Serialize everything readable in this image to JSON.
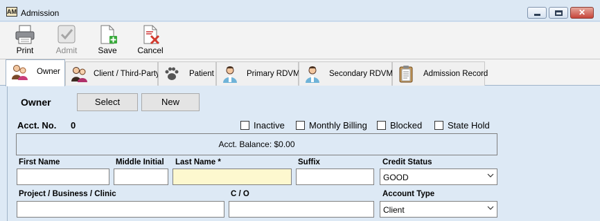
{
  "window": {
    "title": "Admission",
    "app_icon_text": "AM",
    "close_glyph": "✕"
  },
  "toolbar": {
    "print_label": "Print",
    "admit_label": "Admit",
    "save_label": "Save",
    "cancel_label": "Cancel"
  },
  "tabs": [
    {
      "label": "Owner",
      "icon": "owner-people-icon",
      "active": true
    },
    {
      "label": "Client / Third-Party",
      "icon": "client-people-icon"
    },
    {
      "label": "Patient",
      "icon": "paw-print-icon"
    },
    {
      "label": "Primary RDVM",
      "icon": "doctor-icon"
    },
    {
      "label": "Secondary RDVM",
      "icon": "doctor-icon"
    },
    {
      "label": "Admission Record",
      "icon": "clipboard-icon"
    }
  ],
  "owner": {
    "section_title": "Owner",
    "select_label": "Select",
    "new_label": "New",
    "acct_label": "Acct. No.",
    "acct_value": "0",
    "checkboxes": {
      "inactive": "Inactive",
      "monthly_billing": "Monthly Billing",
      "blocked": "Blocked",
      "state_hold": "State Hold"
    },
    "balance_text": "Acct. Balance: $0.00",
    "labels": {
      "first_name": "First Name",
      "middle_initial": "Middle Initial",
      "last_name": "Last Name *",
      "suffix": "Suffix",
      "credit_status": "Credit Status",
      "project": "Project / Business / Clinic",
      "co": "C / O",
      "account_type": "Account Type"
    },
    "values": {
      "first_name": "",
      "middle_initial": "",
      "last_name": "",
      "suffix": "",
      "credit_status": "GOOD",
      "project": "",
      "co": "",
      "account_type": "Client"
    }
  },
  "colors": {
    "content_bg": "#dde9f5",
    "required_field_bg": "#fdf8cf",
    "close_button": "#c6453a"
  }
}
